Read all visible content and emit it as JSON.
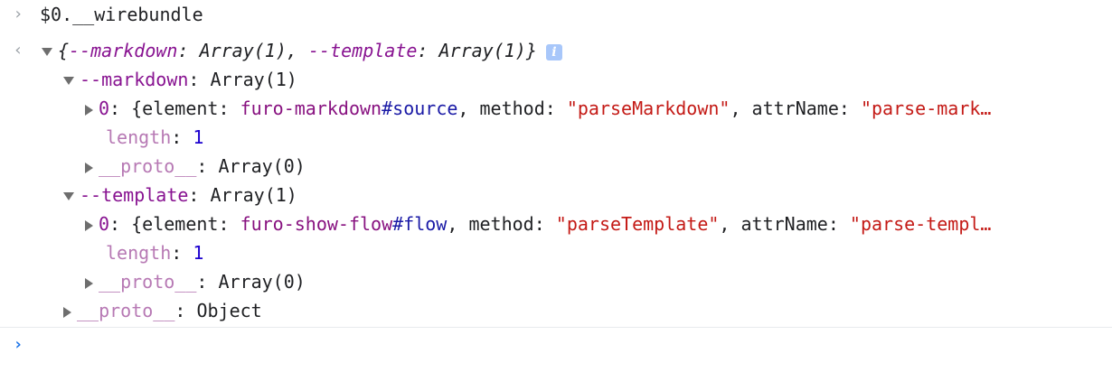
{
  "command": {
    "prompt_glyph": "›",
    "text": "$0.__wirebundle"
  },
  "result": {
    "return_glyph": "‹",
    "summary_open": "{",
    "summary_k1": "--markdown",
    "summary_v1": "Array(1)",
    "summary_sep": ", ",
    "summary_k2": "--template",
    "summary_v2": "Array(1)",
    "summary_close": "}",
    "info_icon_text": "i"
  },
  "markdown": {
    "key": "--markdown",
    "value": "Array(1)",
    "item0": {
      "index": "0",
      "open": "{element: ",
      "elem_tag": "furo-markdown",
      "elem_id": "#source",
      "mid1": ", method: ",
      "method": "\"parseMarkdown\"",
      "mid2": ", attrName: ",
      "attr": "\"parse-mark…"
    },
    "length_key": "length",
    "length_val": "1",
    "proto_key": "__proto__",
    "proto_val": "Array(0)"
  },
  "template": {
    "key": "--template",
    "value": "Array(1)",
    "item0": {
      "index": "0",
      "open": "{element: ",
      "elem_tag": "furo-show-flow",
      "elem_id": "#flow",
      "mid1": ", method: ",
      "method": "\"parseTemplate\"",
      "mid2": ", attrName: ",
      "attr": "\"parse-templ…"
    },
    "length_key": "length",
    "length_val": "1",
    "proto_key": "__proto__",
    "proto_val": "Array(0)"
  },
  "root_proto": {
    "key": "__proto__",
    "value": "Object"
  },
  "input_prompt_glyph": "›"
}
